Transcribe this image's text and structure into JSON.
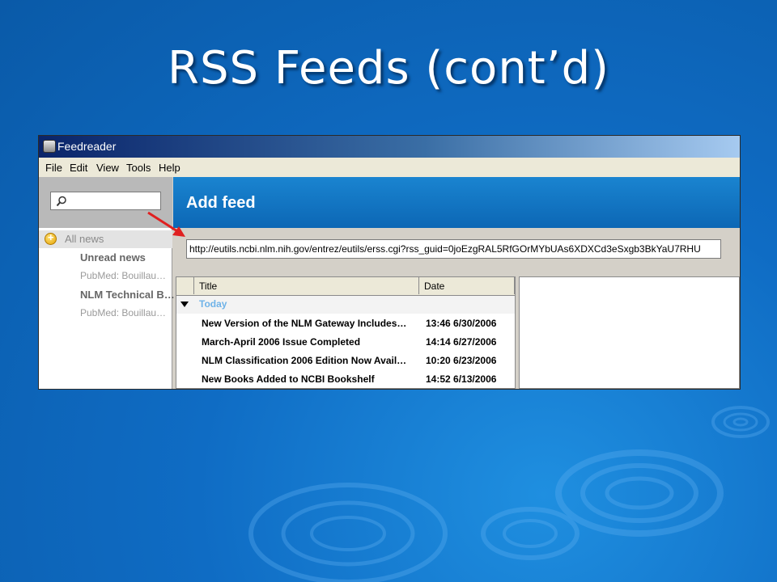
{
  "slide": {
    "title": "RSS Feeds (cont’d)"
  },
  "window": {
    "title": "Feedreader"
  },
  "menu": {
    "items": [
      "File",
      "Edit",
      "View",
      "Tools",
      "Help"
    ]
  },
  "search": {
    "value": ""
  },
  "sidebar": {
    "items": [
      {
        "label": "All news"
      },
      {
        "label": "Unread news"
      },
      {
        "label": "PubMed: Bouillau…"
      },
      {
        "label": "NLM Technical B…"
      },
      {
        "label": "PubMed: Bouillau…"
      }
    ]
  },
  "header": {
    "title": "Add feed"
  },
  "url": {
    "value": "http://eutils.ncbi.nlm.nih.gov/entrez/eutils/erss.cgi?rss_guid=0joEzgRAL5RfGOrMYbUAs6XDXCd3eSxgb3BkYaU7RHU"
  },
  "list": {
    "columns": {
      "title": "Title",
      "date": "Date"
    },
    "group": "Today",
    "rows": [
      {
        "title": "New Version of the NLM Gateway Includes…",
        "date": "13:46 6/30/2006"
      },
      {
        "title": "March-April 2006 Issue Completed",
        "date": "14:14 6/27/2006"
      },
      {
        "title": "NLM Classification 2006 Edition Now Avail…",
        "date": "10:20 6/23/2006"
      },
      {
        "title": "New Books Added to NCBI Bookshelf",
        "date": "14:52 6/13/2006"
      }
    ]
  },
  "colors": {
    "slide_background": "#0f6cc4",
    "header_band": "#1a84d0",
    "arrow": "#e02020",
    "group_label": "#6fb3e8"
  },
  "icons": [
    "search-icon",
    "app-icon",
    "folder-icon",
    "chevron-down-icon",
    "arrow-icon"
  ]
}
